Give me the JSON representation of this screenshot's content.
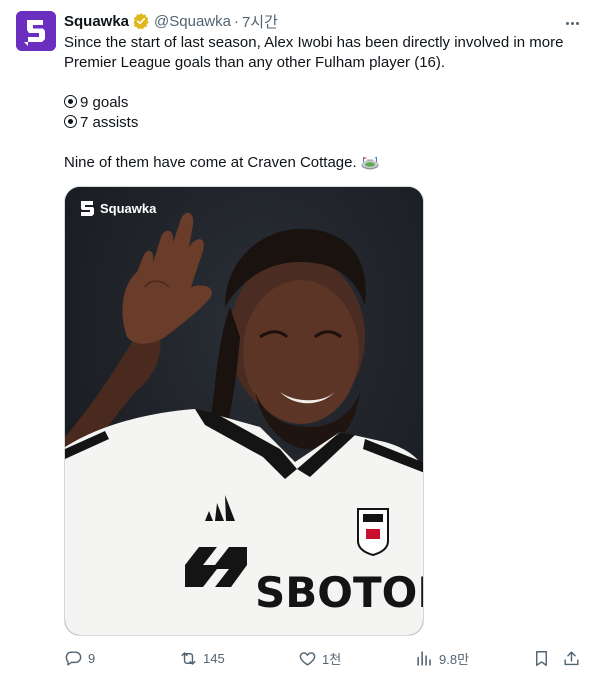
{
  "post": {
    "author_name": "Squawka",
    "author_handle": "@Squawka",
    "separator": "·",
    "timestamp": "7시간",
    "text_lines": [
      "Since the start of last season, Alex Iwobi has been directly involved in more",
      "Premier League goals than any other Fulham player (16)."
    ],
    "stats": [
      "9 goals",
      "7 assists"
    ],
    "closing_line": "Nine of them have come at Craven Cottage.",
    "media": {
      "watermark": "Squawka",
      "shirt_sponsor": "SBOTOP"
    }
  },
  "actions": {
    "replies": "9",
    "reposts": "145",
    "likes": "1천",
    "views": "9.8만"
  },
  "icons": [
    "squawka-logo-icon",
    "verified-badge-icon",
    "more-icon",
    "radio-bullet-icon",
    "stadium-emoji-icon",
    "reply-icon",
    "repost-icon",
    "like-icon",
    "views-icon",
    "bookmark-icon",
    "share-icon"
  ],
  "colors": {
    "avatar_bg": "#6b2fbf",
    "verified_gold": "#e2b719",
    "muted_text": "#536471",
    "media_bg": "#1d2126"
  }
}
